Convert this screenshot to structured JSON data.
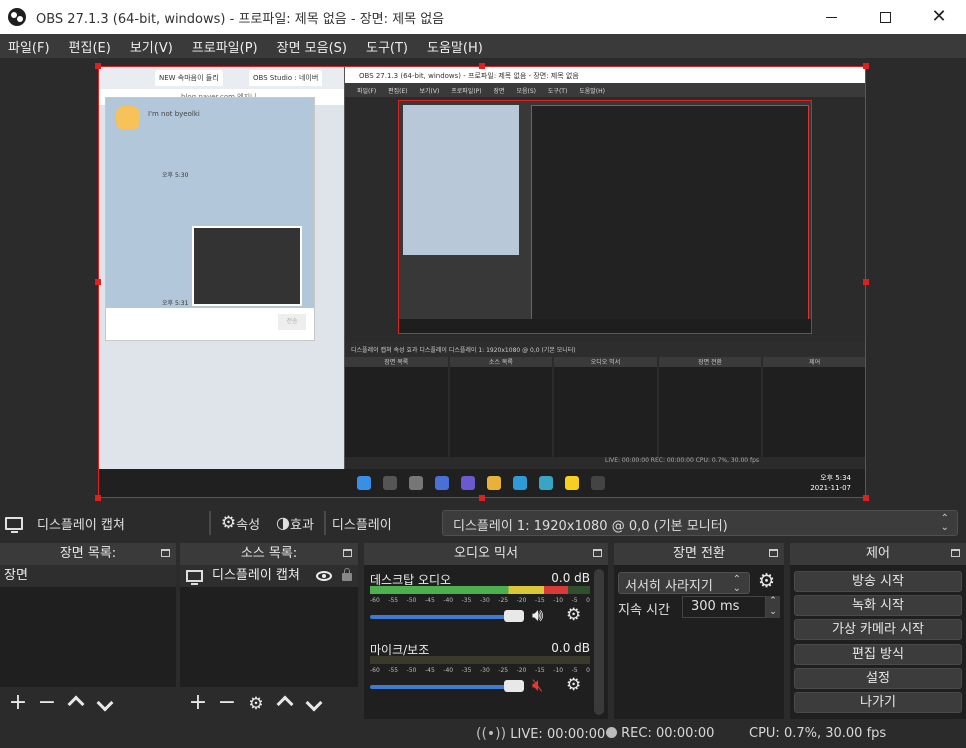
{
  "window": {
    "title": "OBS 27.1.3 (64-bit, windows) - 프로파일: 제목 없음 - 장면: 제목 없음",
    "minimize_glyph": "",
    "close_glyph": "✕"
  },
  "menu": {
    "items": [
      "파일(F)",
      "편집(E)",
      "보기(V)",
      "프로파일(P)",
      "장면 모음(S)",
      "도구(T)",
      "도움말(H)"
    ]
  },
  "preview": {
    "browser_tab_1": "NEW 속마음이 들리",
    "browser_tab_2": "OBS Studio : 네이버",
    "browser_url": "blog.naver.com 엔지니 사랑 하니(동생...",
    "chat_name": "I'm not byeolki",
    "chat_time_1": "오후 5:30",
    "chat_time_2": "오후 5:31",
    "chat_send": "전송",
    "nested_title": "OBS 27.1.3 (64-bit, windows) - 프로파일: 제목 없음 - 장면: 제목 없음",
    "nested_menu": "파일(F) 편집(E) 보기(V) 프로파일(P) 장면 모음(S) 도구(T) 도움말(H)",
    "nested_toolbar": "디스플레이 캡쳐   속성  효과   디스플레이  디스플레이 1: 1920x1080 @ 0,0 (기본 모니터)",
    "nested_docks": [
      "장면 목록",
      "소스 목록",
      "오디오 믹서",
      "장면 전환",
      "제어"
    ],
    "nested_status": "LIVE: 00:00:00   REC: 00:00:00   CPU: 0.7%, 30.00 fps",
    "tray_time": "오후 5:34",
    "tray_date": "2021-11-07"
  },
  "source_toolbar": {
    "source_name": "디스플레이 캡쳐",
    "properties_label": "속성",
    "filters_label": "효과",
    "display_label": "디스플레이",
    "display_value": "디스플레이 1: 1920x1080 @ 0,0 (기본 모니터)"
  },
  "scenes": {
    "header": "장면 목록:",
    "items": [
      "장면"
    ]
  },
  "sources": {
    "header": "소스 목록:",
    "items": [
      "디스플레이 캡쳐"
    ]
  },
  "mixer": {
    "header": "오디오 믹서",
    "scale": [
      "-60",
      "-55",
      "-50",
      "-45",
      "-40",
      "-35",
      "-30",
      "-25",
      "-20",
      "-15",
      "-10",
      "-5",
      "0"
    ],
    "channels": [
      {
        "name": "데스크탑 오디오",
        "db": "0.0 dB",
        "muted": false,
        "level": 0.9
      },
      {
        "name": "마이크/보조",
        "db": "0.0 dB",
        "muted": true,
        "level": 0.0
      }
    ]
  },
  "transitions": {
    "header": "장면 전환",
    "selected": "서서히 사라지기",
    "duration_label": "지속 시간",
    "duration_value": "300 ms"
  },
  "controls": {
    "header": "제어",
    "buttons": [
      "방송 시작",
      "녹화 시작",
      "가상 카메라 시작",
      "편집 방식",
      "설정",
      "나가기"
    ]
  },
  "status": {
    "live": "LIVE: 00:00:00",
    "rec": "REC: 00:00:00",
    "cpu": "CPU: 0.7%, 30.00 fps"
  },
  "colors": {
    "accent_red": "#e02020",
    "meter_green": "#4caf50",
    "meter_yellow": "#d8c83a",
    "meter_red": "#d83a3a",
    "slider_blue": "#3d7ad6",
    "mute_red": "#e53935"
  }
}
